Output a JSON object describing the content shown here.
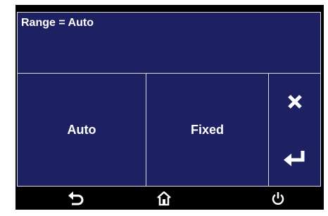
{
  "header": {
    "text": "Range = Auto"
  },
  "options": [
    {
      "label": "Auto"
    },
    {
      "label": "Fixed"
    }
  ],
  "side_icons": {
    "cancel": "close-icon",
    "enter": "enter-icon"
  },
  "nav_icons": {
    "back": "back-icon",
    "home": "home-icon",
    "power": "power-icon"
  },
  "colors": {
    "panel": "#1e2161",
    "frame": "#000000",
    "divider": "#d8dae6",
    "text": "#ffffff"
  }
}
